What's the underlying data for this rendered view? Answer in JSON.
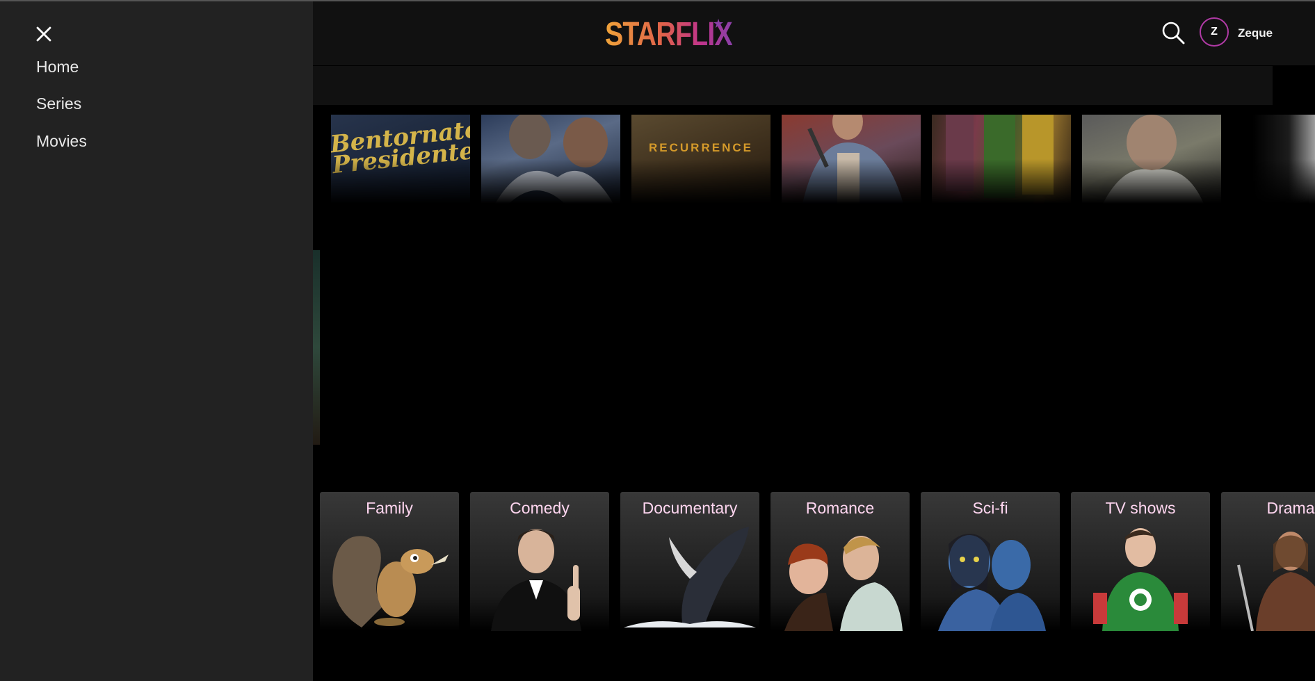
{
  "header": {
    "logo": "STARFLIX",
    "logo_star": "★",
    "user": {
      "initial": "Z",
      "name": "Zeque"
    }
  },
  "drawer": {
    "items": [
      {
        "label": "Home"
      },
      {
        "label": "Series"
      },
      {
        "label": "Movies"
      }
    ]
  },
  "banner": {
    "posters": [
      {
        "text": ""
      },
      {
        "text": "Bentornato Presidente"
      },
      {
        "text": ""
      },
      {
        "text": "RECURRENCE"
      },
      {
        "text": ""
      },
      {
        "text": ""
      },
      {
        "text": ""
      },
      {
        "text": ""
      }
    ]
  },
  "categories": [
    {
      "label": "Family"
    },
    {
      "label": "Comedy"
    },
    {
      "label": "Documentary"
    },
    {
      "label": "Romance"
    },
    {
      "label": "Sci-fi"
    },
    {
      "label": "TV shows"
    },
    {
      "label": "Drama"
    }
  ],
  "colors": {
    "drawer_bg": "#222222",
    "header_bg": "#111111",
    "avatar_ring": "#b03aa5",
    "category_label": "#ffd6f0"
  }
}
